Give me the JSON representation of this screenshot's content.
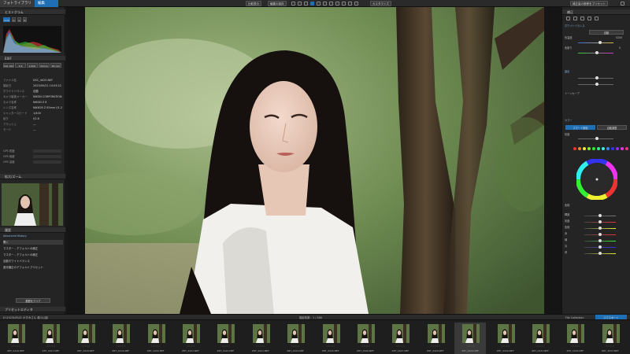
{
  "tabs": {
    "library": "フォトライブラリ",
    "edit": "編集"
  },
  "toolbar": {
    "compare_label": "比較表示",
    "edit_label": "編集の保存",
    "right_label": "補正量の推移をプリセット",
    "workspace_label": "カスタマイズ"
  },
  "left": {
    "histogram_title": "ヒストグラム",
    "exif_title": "EXIF",
    "chips": [
      "ISO 160",
      "2.8",
      "1/400",
      "50mm",
      "85 mm"
    ],
    "info": [
      {
        "k": "ファイル名",
        "v": "DSC_4425.NEF"
      },
      {
        "k": "撮影日",
        "v": "2023/05/21 14:03:22"
      },
      {
        "k": "ホワイトバランス",
        "v": "自動"
      },
      {
        "k": "カメラ製造メーカー",
        "v": "NIKON CORPORATION"
      },
      {
        "k": "カメラ名称",
        "v": "NIKON Z 8"
      },
      {
        "k": "レンズ名称",
        "v": "NIKKOR Z 85mm f/1.2 S"
      },
      {
        "k": "シャッタースピード",
        "v": "1/400"
      },
      {
        "k": "絞り",
        "v": "f/2.8"
      },
      {
        "k": "フラッシュ",
        "v": "—"
      },
      {
        "k": "モード",
        "v": "—"
      }
    ],
    "gps": [
      {
        "k": "GPS 緯度",
        "v": ""
      },
      {
        "k": "GPS 経度",
        "v": ""
      },
      {
        "k": "GPS 高度",
        "v": ""
      }
    ],
    "nav_title": "拡大/ズーム",
    "history_title": "履歴",
    "history_sub": "Advanced History",
    "history": [
      "開く",
      "マスター - デフォルトの補正",
      "マスター - デフォルトの補正",
      "自動ホワイトバランス",
      "遮光補正のデフォルトプリセット"
    ],
    "history_clear": "履歴をクリア",
    "preset_title": "プリセットエディタ"
  },
  "right": {
    "header": "補正",
    "section_wb": "ホワイトバランス",
    "wb_mode": "自動",
    "temp_label": "色温度",
    "temp_value": "5200",
    "tint_label": "色被り",
    "tint_value": "0",
    "section_exposure": "露出",
    "tone_label": "トーンカーブ",
    "section_color": "カラー",
    "btn_a": "スマート調色",
    "btn_b": "自動調整",
    "sat_label": "彩度",
    "hue_label": "色相",
    "sliders": [
      "輝度",
      "彩度",
      "色相",
      "赤",
      "緑",
      "青",
      "黄"
    ]
  },
  "filmbar": {
    "path": "E:\\2023\\05\\21 かすみさん 湯川公園",
    "count": "撮影枚数：1 / 380",
    "collection": "File Collection",
    "export": "エクスポート"
  },
  "thumbs": [
    "Z8T_4416.NEF",
    "Z8T_4417.NEF",
    "Z8T_4418.NEF",
    "Z8T_4419.NEF",
    "Z8T_4420.NEF",
    "Z8T_4421.NEF",
    "Z8T_4422.NEF",
    "Z8T_4423.NEF",
    "Z8T_4424.NEF",
    "Z8T_4425.NEF",
    "Z8T_4426.NEF",
    "Z8T_4427.NEF",
    "Z8T_4428.NEF",
    "Z8T_4429.NEF",
    "Z8T_4430.NEF",
    "Z8T_4431.NEF",
    "Z8T_4432.NEF",
    "Z8T_4433.NEF"
  ],
  "colors": {
    "accent": "#1f6fb5",
    "panel": "#242424",
    "bg": "#151515"
  }
}
